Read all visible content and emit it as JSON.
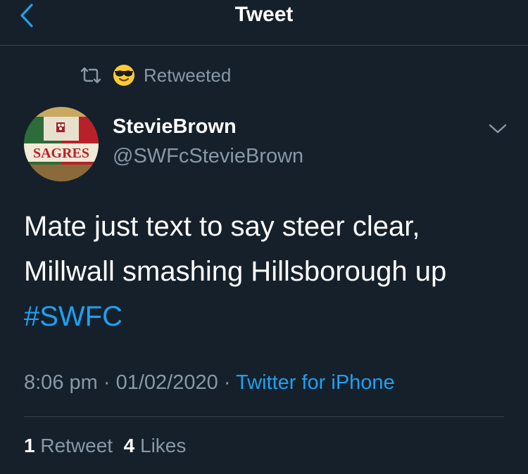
{
  "header": {
    "title": "Tweet",
    "back_icon": "chevron-left-icon",
    "accent": "#1da1f2"
  },
  "retweet_banner": {
    "text": "Retweeted",
    "icons": [
      "retweet-icon",
      "smiling-face-with-sunglasses-icon"
    ]
  },
  "author": {
    "display_name": "StevieBrown",
    "handle": "@SWFcStevieBrown",
    "avatar_icon": "sagres-beer-can-avatar",
    "avatar_text": "SAGRES",
    "menu_icon": "chevron-down-icon"
  },
  "tweet": {
    "line1": "Mate just text to say steer clear,",
    "line2": "Millwall smashing Hillsborough up",
    "hashtag": "#SWFC"
  },
  "meta": {
    "time": "8:06 pm",
    "separator": "·",
    "date": "01/02/2020",
    "source": "Twitter for iPhone"
  },
  "stats": {
    "retweets_count": "1",
    "retweets_label": "Retweet",
    "likes_count": "4",
    "likes_label": "Likes"
  },
  "colors": {
    "background": "#15202b",
    "secondary_text": "#8899a6",
    "divider": "#38444d",
    "link": "#1da1f2"
  }
}
